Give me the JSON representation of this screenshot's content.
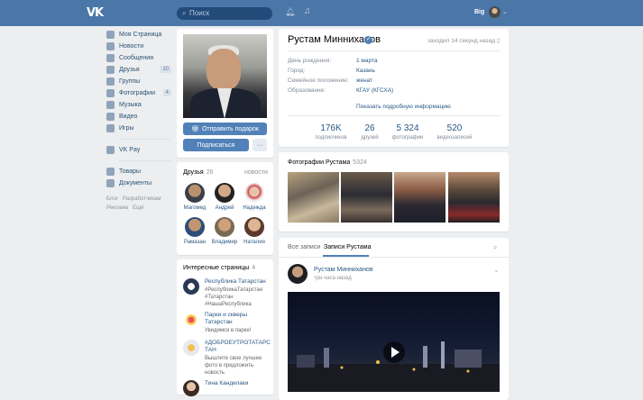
{
  "topbar": {
    "search_placeholder": "Поиск",
    "user_name": "Big"
  },
  "nav": {
    "items": [
      {
        "label": "Моя Страница",
        "icon": "home-icon"
      },
      {
        "label": "Новости",
        "icon": "news-icon"
      },
      {
        "label": "Сообщения",
        "icon": "messages-icon"
      },
      {
        "label": "Друзья",
        "icon": "friends-icon",
        "count": "10"
      },
      {
        "label": "Группы",
        "icon": "groups-icon"
      },
      {
        "label": "Фотографии",
        "icon": "photos-icon",
        "count": "4"
      },
      {
        "label": "Музыка",
        "icon": "music-icon"
      },
      {
        "label": "Видео",
        "icon": "video-icon"
      },
      {
        "label": "Игры",
        "icon": "games-icon"
      }
    ],
    "vkpay": "VK Pay",
    "extra": [
      "Товары",
      "Документы"
    ],
    "footer": [
      "Блог",
      "Разработчикам",
      "Реклама",
      "Ещё"
    ]
  },
  "profile": {
    "name": "Рустам Минниханов",
    "online": "заходил 14 секунд назад",
    "gift_button": "Отправить подарок",
    "subscribe_button": "Подписаться",
    "more_button": "···",
    "info": [
      {
        "label": "День рождения:",
        "value": "1 марта"
      },
      {
        "label": "Город:",
        "value": "Казань"
      },
      {
        "label": "Семейное положение:",
        "value": "женат"
      },
      {
        "label": "Образование:",
        "value": "КГАУ (КГСХА)"
      }
    ],
    "more_info": "Показать подробную информацию",
    "stats": [
      {
        "num": "176K",
        "label": "подписчиков"
      },
      {
        "num": "26",
        "label": "друзей"
      },
      {
        "num": "5 324",
        "label": "фотографии"
      },
      {
        "num": "520",
        "label": "видеозаписей"
      }
    ]
  },
  "friends": {
    "title": "Друзья",
    "count": "26",
    "link": "новости",
    "list": [
      "Магомед",
      "Андрей",
      "Надежда",
      "Рамазан",
      "Владимир",
      "Наталия"
    ]
  },
  "pages": {
    "title": "Интересные страницы",
    "count": "4",
    "list": [
      {
        "title": "Республика Татарстан",
        "sub": "#РеспубликаТатарстан #Татарстан #НашаРеспублика"
      },
      {
        "title": "Парки и скверы Татарстан",
        "sub": "Увидимся в парке!"
      },
      {
        "title": "#ДОБРОЕУТРОТАТАРСТАН",
        "sub": "Вышлите свое лучшее фото в предложить новость"
      },
      {
        "title": "Тина Канделаки",
        "sub": ""
      }
    ]
  },
  "photos": {
    "title": "Фотографии Рустама",
    "count": "5324"
  },
  "wall": {
    "tab_all": "Все записи",
    "tab_own": "Записи Рустама",
    "post_author": "Рустам Минниханов",
    "post_time": "три часа назад"
  }
}
